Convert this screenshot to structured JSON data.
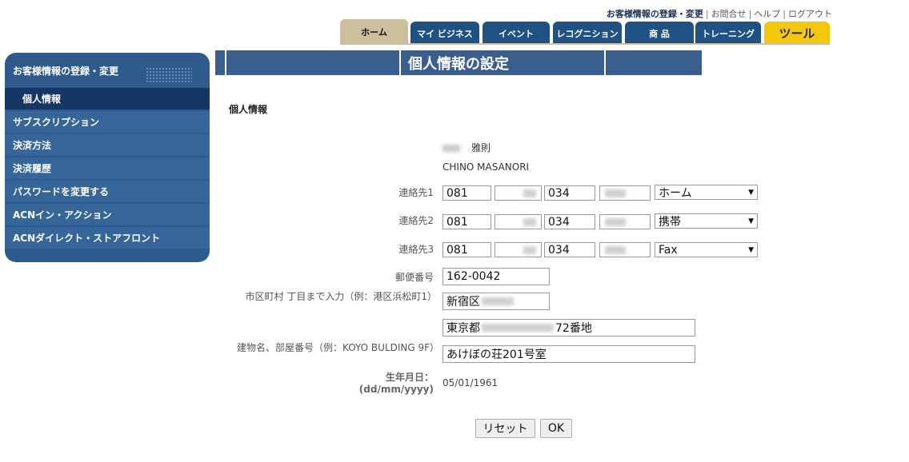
{
  "header": {
    "links": [
      "お客様情報の登録・変更",
      "お問合せ",
      "ヘルプ",
      "ログアウト"
    ],
    "separator": "|"
  },
  "tabs": [
    {
      "label": "ホーム"
    },
    {
      "label": "マイ ビジネス"
    },
    {
      "label": "イベント"
    },
    {
      "label": "レコグニション"
    },
    {
      "label": "商 品"
    },
    {
      "label": "トレーニング"
    },
    {
      "label": "ツール"
    }
  ],
  "sidebar": {
    "title": "お客様情報の登録・変更",
    "items": [
      {
        "label": "個人情報",
        "active": true
      },
      {
        "label": "サブスクリプション"
      },
      {
        "label": "決済方法"
      },
      {
        "label": "決済履歴"
      },
      {
        "label": "パスワードを変更する"
      },
      {
        "label": "ACNイン・アクション"
      },
      {
        "label": "ACNダイレクト・ストアフロント"
      }
    ]
  },
  "page": {
    "title": "個人情報の設定",
    "section": "個人情報"
  },
  "name": {
    "kanji_given": "雅則",
    "roman": "CHINO   MASANORI"
  },
  "contacts": [
    {
      "label": "連絡先1",
      "p1": "081",
      "p2": "034",
      "type": "ホーム"
    },
    {
      "label": "連絡先2",
      "p1": "081",
      "p2": "034",
      "type": "携帯"
    },
    {
      "label": "連絡先3",
      "p1": "081",
      "p2": "034",
      "type": "Fax"
    }
  ],
  "postal": {
    "label": "郵便番号",
    "value": "162-0042"
  },
  "city": {
    "label": "市区町村 丁目まで入力（例：港区浜松町1）",
    "value": "新宿区"
  },
  "address": {
    "prefix": "東京都",
    "suffix": "72番地"
  },
  "building": {
    "label": "建物名、部屋番号（例：KOYO BULDING 9F）",
    "value": "あけぼの荘201号室"
  },
  "birthdate": {
    "label_line1": "生年月日：",
    "label_line2": "(dd/mm/yyyy)",
    "value": "05/01/1961"
  },
  "buttons": {
    "reset": "リセット",
    "ok": "OK"
  },
  "colors": {
    "navy": "#2e5a8c",
    "gold": "#f3c70d",
    "beige": "#cbbf9c"
  }
}
